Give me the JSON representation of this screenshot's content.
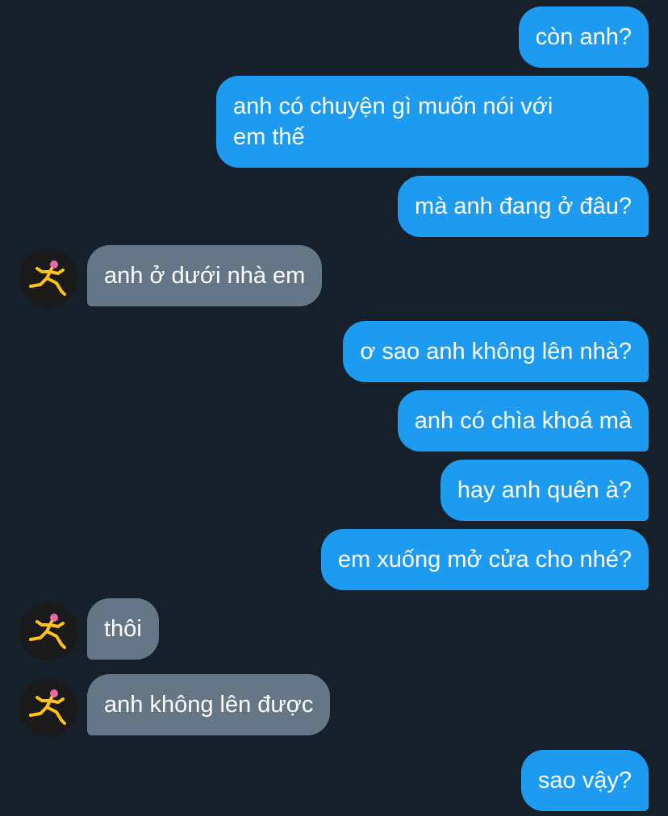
{
  "conversation": {
    "messages": [
      {
        "direction": "outgoing",
        "text": "còn anh?"
      },
      {
        "direction": "outgoing",
        "text": "anh có chuyện gì muốn nói với\nem thế"
      },
      {
        "direction": "outgoing",
        "text": "mà anh đang ở đâu?"
      },
      {
        "direction": "incoming",
        "text": "anh ở dưới nhà em",
        "avatar": "running-figure-avatar"
      },
      {
        "direction": "outgoing",
        "text": "ơ sao anh không lên nhà?"
      },
      {
        "direction": "outgoing",
        "text": "anh có chìa khoá mà"
      },
      {
        "direction": "outgoing",
        "text": "hay anh quên à?"
      },
      {
        "direction": "outgoing",
        "text": "em xuống mở cửa cho nhé?"
      },
      {
        "direction": "incoming",
        "text": "thôi",
        "avatar": "running-figure-avatar"
      },
      {
        "direction": "incoming",
        "text": "anh không lên được",
        "avatar": "running-figure-avatar"
      },
      {
        "direction": "outgoing",
        "text": "sao vậy?"
      }
    ]
  },
  "colors": {
    "background": "#15202b",
    "outgoing_bubble": "#1d9bf0",
    "incoming_bubble": "#657786",
    "text": "#ffffff",
    "avatar_figure": "#ffc21a",
    "avatar_head": "#e86aa0"
  }
}
